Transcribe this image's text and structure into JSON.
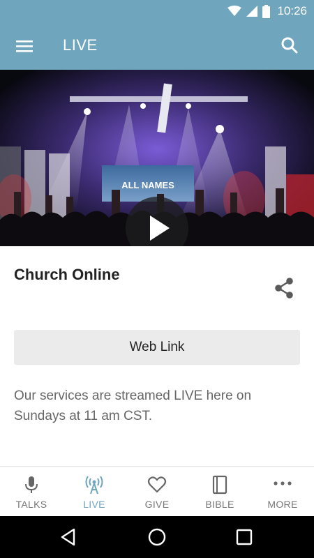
{
  "status_bar": {
    "time": "10:26",
    "icons": [
      "wifi-icon",
      "cell-signal-icon",
      "battery-icon"
    ]
  },
  "app_bar": {
    "title": "LIVE",
    "menu_icon": "hamburger-menu-icon",
    "search_icon": "search-icon",
    "color": "#6fa5bd"
  },
  "video": {
    "play_icon": "play-icon",
    "screen_text": "ALL NAMES"
  },
  "content": {
    "title": "Church Online",
    "share_icon": "share-icon",
    "web_link_label": "Web Link",
    "description": "Our services are streamed LIVE here on Sundays at 11 am CST."
  },
  "bottom_nav": {
    "active_color": "#6fa5bd",
    "items": [
      {
        "label": "TALKS",
        "icon": "microphone-icon"
      },
      {
        "label": "LIVE",
        "icon": "broadcast-icon",
        "active": true
      },
      {
        "label": "GIVE",
        "icon": "heart-icon"
      },
      {
        "label": "BIBLE",
        "icon": "book-icon"
      },
      {
        "label": "MORE",
        "icon": "more-dots-icon"
      }
    ]
  },
  "system_nav": {
    "icons": [
      "back-icon",
      "home-icon",
      "recents-icon"
    ]
  }
}
